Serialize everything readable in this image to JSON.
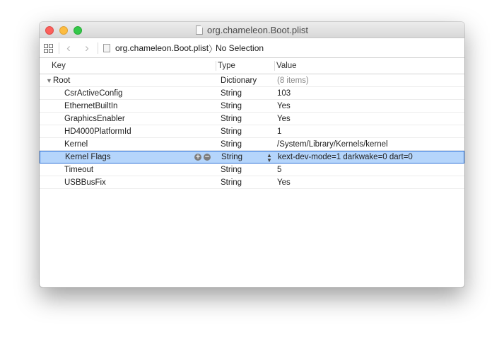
{
  "window": {
    "title": "org.chameleon.Boot.plist"
  },
  "jumpbar": {
    "file": "org.chameleon.Boot.plist",
    "selection": "No Selection",
    "back_glyph": "‹",
    "forward_glyph": "›",
    "separator_glyph": "〉"
  },
  "columns": {
    "key": "Key",
    "type": "Type",
    "value": "Value"
  },
  "root": {
    "key": "Root",
    "type": "Dictionary",
    "value": "(8 items)",
    "disclosure": "▼"
  },
  "rows": [
    {
      "key": "CsrActiveConfig",
      "type": "String",
      "value": "103"
    },
    {
      "key": "EthernetBuiltIn",
      "type": "String",
      "value": "Yes"
    },
    {
      "key": "GraphicsEnabler",
      "type": "String",
      "value": "Yes"
    },
    {
      "key": "HD4000PlatformId",
      "type": "String",
      "value": "1"
    },
    {
      "key": "Kernel",
      "type": "String",
      "value": "/System/Library/Kernels/kernel"
    },
    {
      "key": "Kernel Flags",
      "type": "String",
      "value": "kext-dev-mode=1 darkwake=0 dart=0"
    },
    {
      "key": "Timeout",
      "type": "String",
      "value": "5"
    },
    {
      "key": "USBBusFix",
      "type": "String",
      "value": "Yes"
    }
  ],
  "row_controls": {
    "add": "+",
    "remove": "−",
    "stepper": "⌃⌄"
  },
  "icons": {
    "grid": "related-items-grid-icon",
    "file": "plist-file-icon"
  },
  "colors": {
    "selection": "#b5d5fb",
    "selection_border": "#2a70d8",
    "close": "#fc605c",
    "minimize": "#fdbc40",
    "maximize": "#34c84a"
  }
}
